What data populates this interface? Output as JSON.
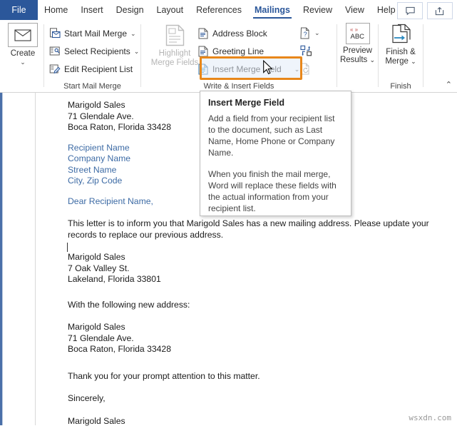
{
  "tabs": [
    {
      "label": "File",
      "active": false,
      "file": true
    },
    {
      "label": "Home",
      "active": false
    },
    {
      "label": "Insert",
      "active": false
    },
    {
      "label": "Design",
      "active": false
    },
    {
      "label": "Layout",
      "active": false
    },
    {
      "label": "References",
      "active": false
    },
    {
      "label": "Mailings",
      "active": true
    },
    {
      "label": "Review",
      "active": false
    },
    {
      "label": "View",
      "active": false
    },
    {
      "label": "Help",
      "active": false
    }
  ],
  "title_buttons": [
    {
      "name": "comment-icon",
      "label": "Comments"
    },
    {
      "name": "share-icon",
      "label": "Share"
    }
  ],
  "ribbon": {
    "collapse_chevron": "⌃",
    "groups": [
      {
        "id": "create",
        "label": "",
        "buttons": [
          {
            "label": "Create",
            "icon": "envelope-icon",
            "dropdown": "⌄"
          }
        ]
      },
      {
        "id": "start_mail_merge",
        "label": "Start Mail Merge",
        "buttons": [
          {
            "label": "Start Mail Merge",
            "icon": "start-mail-merge-icon",
            "dropdown": "⌄",
            "disabled": false
          },
          {
            "label": "Select Recipients",
            "icon": "select-recipients-icon",
            "dropdown": "⌄",
            "disabled": false
          },
          {
            "label": "Edit Recipient List",
            "icon": "edit-recipient-list-icon",
            "dropdown": "",
            "disabled": false
          }
        ]
      },
      {
        "id": "write_insert_fields",
        "label": "Write & Insert Fields",
        "buttons": [
          {
            "label": "Highlight Merge Fields",
            "icon": "highlight-merge-fields-icon",
            "disabled": true
          },
          {
            "label": "Address Block",
            "icon": "address-block-icon",
            "disabled": false
          },
          {
            "label": "Greeting Line",
            "icon": "greeting-line-icon",
            "disabled": false
          },
          {
            "label": "Insert Merge Field",
            "icon": "insert-merge-field-icon",
            "dropdown": "⌄",
            "disabled": false,
            "highlighted": true
          },
          {
            "label": "Rules",
            "icon": "rules-icon",
            "dropdown": "⌄",
            "disabled": false
          },
          {
            "label": "Match Fields",
            "icon": "match-fields-icon",
            "disabled": false
          },
          {
            "label": "Update Labels",
            "icon": "update-labels-icon",
            "disabled": true
          }
        ]
      },
      {
        "id": "preview_results",
        "label": "",
        "buttons": [
          {
            "label": "Preview\nResults",
            "icon": "abc-preview-icon",
            "dropdown": "⌄"
          }
        ]
      },
      {
        "id": "finish",
        "label": "Finish",
        "buttons": [
          {
            "label": "Finish &\nMerge",
            "icon": "finish-merge-icon",
            "dropdown": "⌄"
          }
        ]
      }
    ],
    "labels": {
      "create": "Create",
      "create_chevron": "⌄",
      "start_mail_merge": "Start Mail Merge",
      "select_recipients": "Select Recipients",
      "edit_recipient_list": "Edit Recipient List",
      "start_mail_merge_group": "Start Mail Merge",
      "highlight_merge_fields_l1": "Highlight",
      "highlight_merge_fields_l2": "Merge Fields",
      "address_block": "Address Block",
      "greeting_line": "Greeting Line",
      "insert_merge_field": "Insert Merge Field",
      "write_insert_fields_group": "Write & Insert Fields",
      "preview_results_l1": "Preview",
      "preview_results_l2": "Results",
      "finish_merge_l1": "Finish &",
      "finish_merge_l2": "Merge",
      "finish_group": "Finish",
      "dropdown_chevron": "⌄",
      "abc_text": "ABC"
    }
  },
  "tooltip": {
    "title": "Insert Merge Field",
    "paragraph1": "Add a field from your recipient list to the document, such as Last Name, Home Phone or Company Name.",
    "paragraph2": "When you finish the mail merge, Word will replace these fields with the actual information from your recipient list."
  },
  "document": {
    "sender_block": [
      "Marigold Sales",
      "71 Glendale Ave.",
      "Boca Raton, Florida 33428"
    ],
    "merge_fields": [
      "Recipient Name",
      "Company Name",
      "Street Name",
      "City, Zip Code"
    ],
    "salutation": "Dear Recipient Name,",
    "body1": "This letter is to inform you that Marigold Sales has a new mailing address. Please update your records to replace our previous address.",
    "old_address": [
      "Marigold Sales",
      "7 Oak Valley St.",
      "Lakeland, Florida 33801"
    ],
    "intro_new_address": "With the following new address:",
    "new_address": [
      "Marigold Sales",
      "71 Glendale Ave.",
      "Boca Raton, Florida 33428"
    ],
    "closing_thanks": "Thank you for your prompt attention to this matter.",
    "closing_sincerely": "Sincerely,",
    "closing_signature": "Marigold Sales"
  },
  "watermark": "wsxdn.com",
  "colors": {
    "brand_blue": "#2b579a",
    "highlight_orange": "#e8871a",
    "merge_field_blue": "#3d6ba5"
  }
}
